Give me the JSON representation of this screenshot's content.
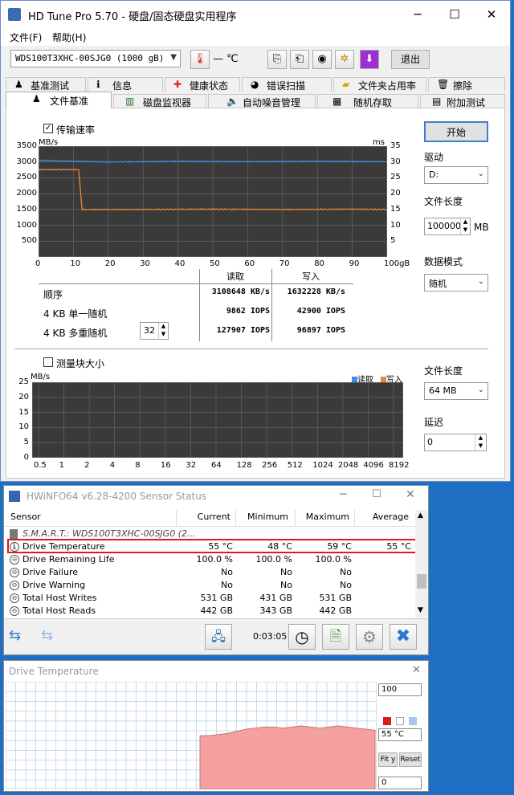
{
  "hdtune": {
    "title": "HD Tune Pro 5.70 - 硬盘/固态硬盘实用程序",
    "menu": [
      "文件(F)",
      "帮助(H)"
    ],
    "drive_select": "WDS100T3XHC-00SJG0 (1000 gB)",
    "temp_value": "— ℃",
    "exit_label": "退出",
    "tabs_row1": [
      {
        "label": "基准测试",
        "icon": "pawn-icon"
      },
      {
        "label": "信息",
        "icon": "info-icon"
      },
      {
        "label": "健康状态",
        "icon": "plus-icon"
      },
      {
        "label": "错误扫描",
        "icon": "scan-icon"
      },
      {
        "label": "文件夹占用率",
        "icon": "folder-icon"
      },
      {
        "label": "擦除",
        "icon": "trash-icon"
      }
    ],
    "tabs_row2": [
      {
        "label": "文件基准",
        "icon": "pawn-icon"
      },
      {
        "label": "磁盘监视器",
        "icon": "chart-icon"
      },
      {
        "label": "自动噪音管理",
        "icon": "speaker-icon"
      },
      {
        "label": "随机存取",
        "icon": "dice-icon"
      },
      {
        "label": "附加测试",
        "icon": "test-icon"
      }
    ],
    "transfer_rate_label": "传输速率",
    "chart_units_left": "MB/s",
    "chart_units_right": "ms",
    "yaxis_left": [
      "3500",
      "3000",
      "2500",
      "2000",
      "1500",
      "1000",
      "500"
    ],
    "yaxis_right": [
      "35",
      "30",
      "25",
      "20",
      "15",
      "10",
      "5"
    ],
    "xaxis": [
      "0",
      "10",
      "20",
      "30",
      "40",
      "50",
      "60",
      "70",
      "80",
      "90",
      "100gB"
    ],
    "results_header": {
      "read": "读取",
      "write": "写入"
    },
    "results": [
      {
        "label": "顺序",
        "read": "3108648 KB/s",
        "write": "1632228 KB/s"
      },
      {
        "label": "4 KB 单一随机",
        "read": "9862 IOPS",
        "write": "42900 IOPS"
      },
      {
        "label": "4 KB 多重随机",
        "read": "127907 IOPS",
        "write": "96897 IOPS"
      }
    ],
    "queue_depth": "32",
    "start_label": "开始",
    "drive_label": "驱动",
    "drive_letter": "D:",
    "file_length_label": "文件长度",
    "file_length_value": "100000",
    "file_length_unit": "MB",
    "data_mode_label": "数据模式",
    "data_mode_value": "随机",
    "block_size_label": "测量块大小",
    "block_units": "MB/s",
    "block_yaxis": [
      "25",
      "20",
      "15",
      "10",
      "5",
      "0"
    ],
    "block_xaxis": [
      "0.5",
      "1",
      "2",
      "4",
      "8",
      "16",
      "32",
      "64",
      "128",
      "256",
      "512",
      "1024",
      "2048",
      "4096",
      "8192"
    ],
    "legend_read": "读取",
    "legend_write": "写入",
    "file_length2_label": "文件长度",
    "file_length2_value": "64 MB",
    "delay_label": "延迟",
    "delay_value": "0",
    "colors": {
      "read": "#3c8fe0",
      "write": "#e8893a",
      "plot_bg": "#3a3a3a"
    }
  },
  "chart_data": {
    "type": "line",
    "title": "",
    "xlabel": "",
    "ylabel": "MB/s",
    "xlim": [
      0,
      100
    ],
    "ylim": [
      0,
      3500
    ],
    "series": [
      {
        "name": "读取",
        "x": [
          0,
          12,
          20,
          40,
          60,
          80,
          100
        ],
        "values": [
          3050,
          3020,
          3000,
          3020,
          3010,
          3020,
          3010
        ]
      },
      {
        "name": "写入",
        "x": [
          0,
          11.5,
          12.5,
          30,
          50,
          70,
          90,
          100
        ],
        "values": [
          2760,
          2760,
          1500,
          1500,
          1510,
          1500,
          1510,
          1500
        ]
      }
    ]
  },
  "hwinfo": {
    "title": "HWiNFO64 v6.28-4200 Sensor Status",
    "columns": [
      "Sensor",
      "Current",
      "Minimum",
      "Maximum",
      "Average"
    ],
    "group": "S.M.A.R.T.: WDS100T3XHC-00SJG0 (2...",
    "rows": [
      {
        "name": "Drive Temperature",
        "current": "55 °C",
        "min": "48 °C",
        "max": "59 °C",
        "avg": "55 °C",
        "icon": "thermometer-icon"
      },
      {
        "name": "Drive Remaining Life",
        "current": "100.0 %",
        "min": "100.0 %",
        "max": "100.0 %",
        "avg": "",
        "icon": "gauge-icon"
      },
      {
        "name": "Drive Failure",
        "current": "No",
        "min": "No",
        "max": "No",
        "avg": "",
        "icon": "gauge-icon"
      },
      {
        "name": "Drive Warning",
        "current": "No",
        "min": "No",
        "max": "No",
        "avg": "",
        "icon": "gauge-icon"
      },
      {
        "name": "Total Host Writes",
        "current": "531 GB",
        "min": "431 GB",
        "max": "531 GB",
        "avg": "",
        "icon": "gauge-icon"
      },
      {
        "name": "Total Host Reads",
        "current": "442 GB",
        "min": "343 GB",
        "max": "442 GB",
        "avg": "",
        "icon": "gauge-icon"
      }
    ],
    "timer": "0:03:05",
    "highlight_color": "#e0191c"
  },
  "graph": {
    "title": "Drive Temperature",
    "max_value": "100",
    "current_value": "55 °C",
    "min_value": "0",
    "fit_label": "Fit y",
    "reset_label": "Reset",
    "fill_color": "#f4a0a0",
    "temp_level": 0.55
  }
}
